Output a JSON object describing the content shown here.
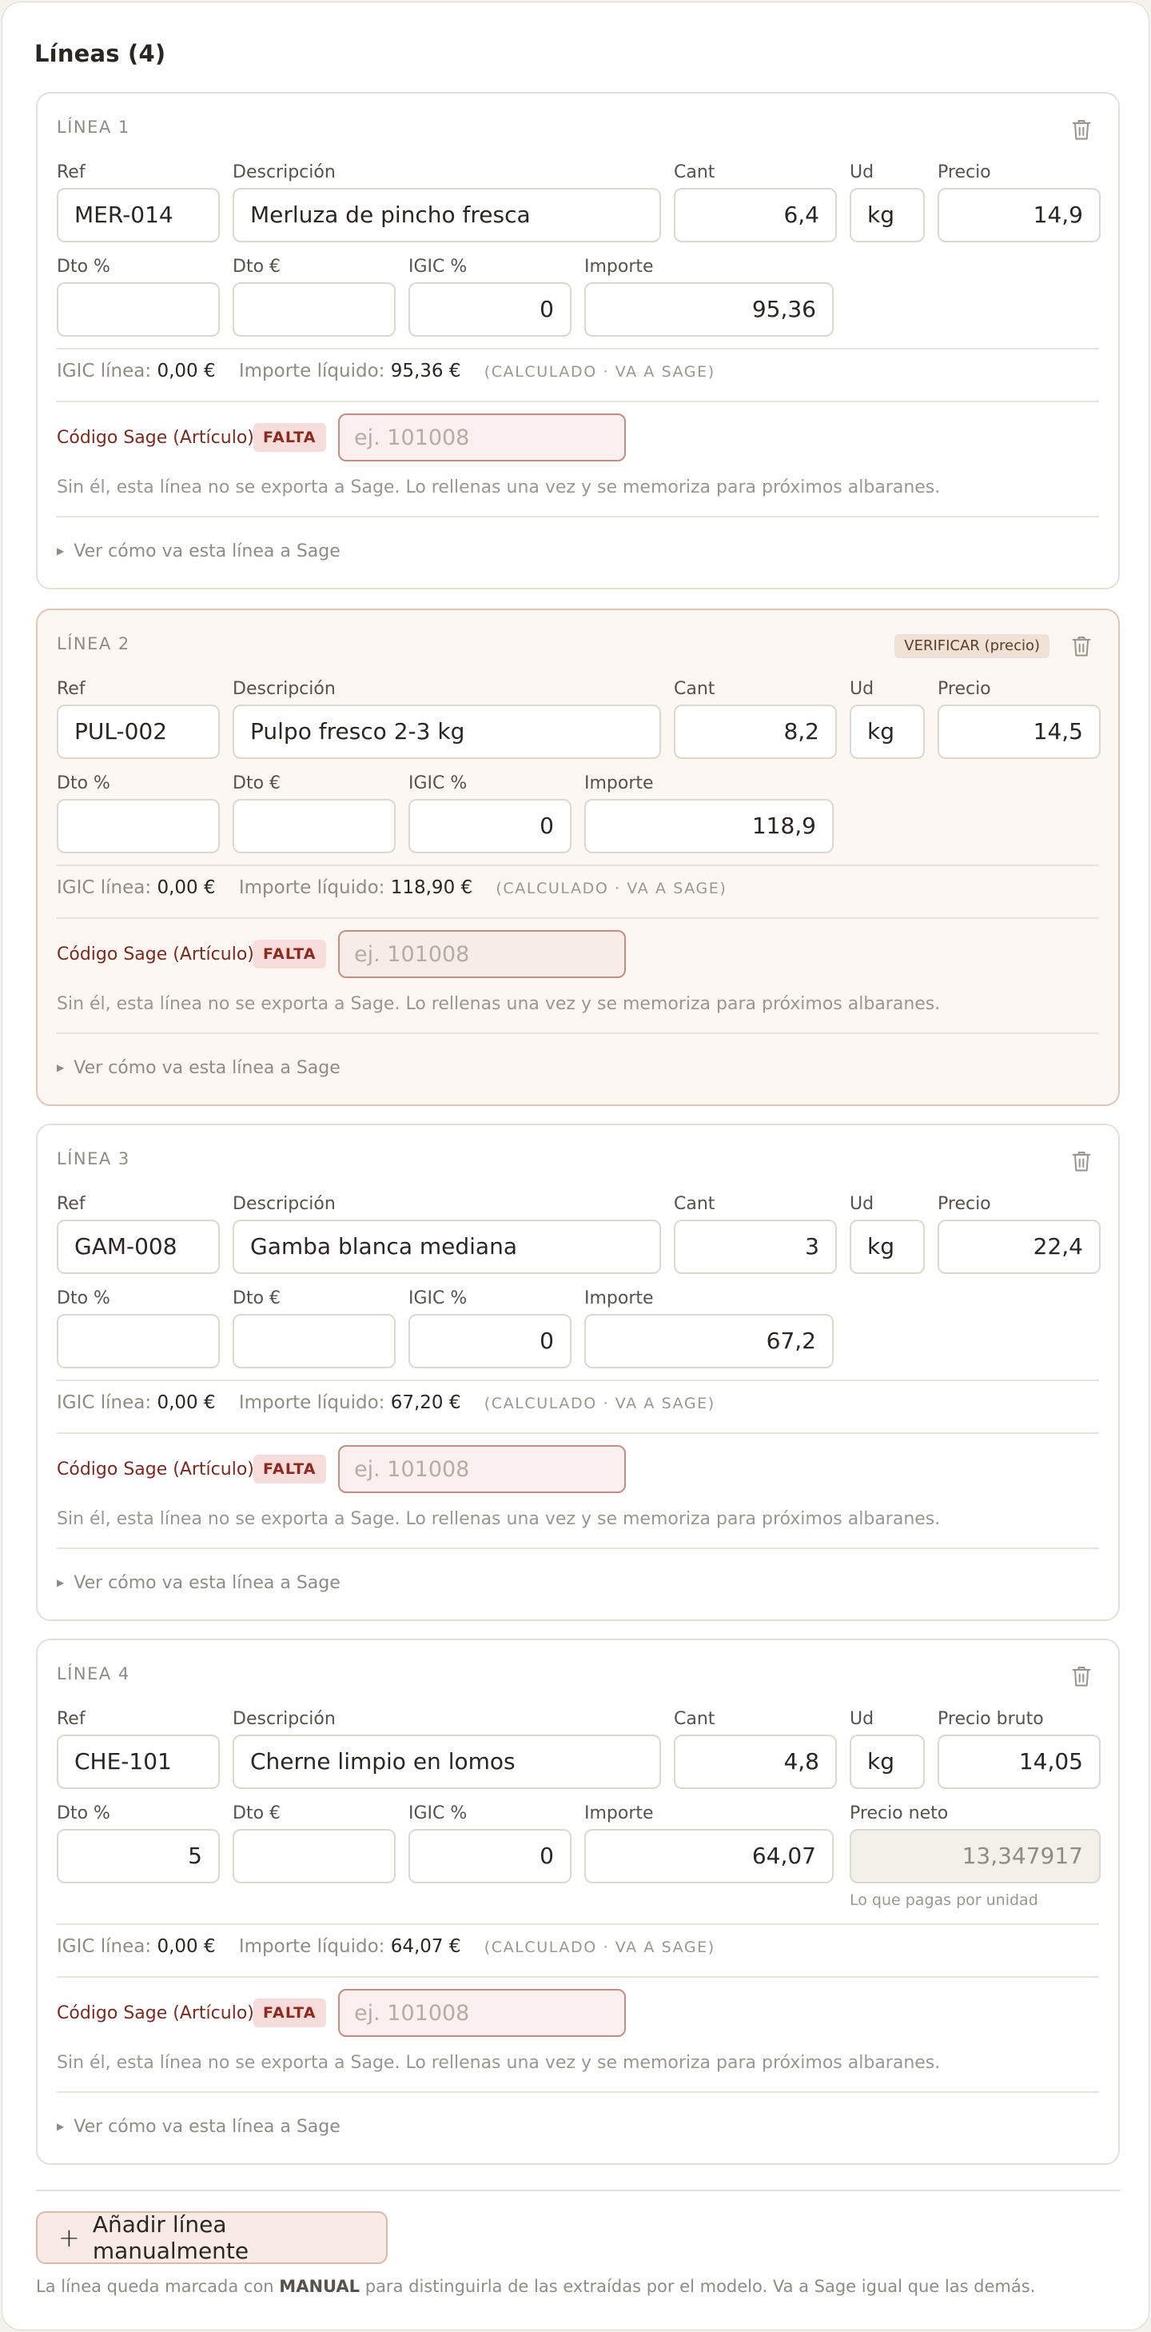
{
  "section": {
    "title": "Líneas (4)"
  },
  "labels": {
    "ref": "Ref",
    "descripcion": "Descripción",
    "cant": "Cant",
    "ud": "Ud",
    "precio": "Precio",
    "precio_bruto": "Precio bruto",
    "dto_pct": "Dto %",
    "dto_eur": "Dto €",
    "igic_pct": "IGIC %",
    "importe": "Importe",
    "precio_neto": "Precio neto",
    "precio_neto_hint": "Lo que pagas por unidad",
    "igic_linea": "IGIC línea:",
    "importe_liquido": "Importe líquido:",
    "calculado": "(CALCULADO · VA A SAGE)",
    "codigo_sage": "Código Sage (Artículo)",
    "falta": "FALTA",
    "sage_placeholder": "ej. 101008",
    "sage_note": "Sin él, esta línea no se exporta a Sage. Lo rellenas una vez y se memoriza para próximos albaranes.",
    "ver_como": "Ver cómo va esta línea a Sage"
  },
  "lines": [
    {
      "label": "LÍNEA 1",
      "verify": "",
      "ref": "MER-014",
      "desc": "Merluza de pincho fresca",
      "cant": "6,4",
      "ud": "kg",
      "precio": "14,9",
      "dto_pct": "",
      "dto_eur": "",
      "igic": "0",
      "importe": "95,36",
      "igic_linea": "0,00 €",
      "importe_liquido": "95,36 €"
    },
    {
      "label": "LÍNEA 2",
      "verify": "VERIFICAR (precio)",
      "ref": "PUL-002",
      "desc": "Pulpo fresco 2-3 kg",
      "cant": "8,2",
      "ud": "kg",
      "precio": "14,5",
      "dto_pct": "",
      "dto_eur": "",
      "igic": "0",
      "importe": "118,9",
      "igic_linea": "0,00 €",
      "importe_liquido": "118,90 €"
    },
    {
      "label": "LÍNEA 3",
      "verify": "",
      "ref": "GAM-008",
      "desc": "Gamba blanca mediana",
      "cant": "3",
      "ud": "kg",
      "precio": "22,4",
      "dto_pct": "",
      "dto_eur": "",
      "igic": "0",
      "importe": "67,2",
      "igic_linea": "0,00 €",
      "importe_liquido": "67,20 €"
    },
    {
      "label": "LÍNEA 4",
      "verify": "",
      "ref": "CHE-101",
      "desc": "Cherne limpio en lomos",
      "cant": "4,8",
      "ud": "kg",
      "precio": "14,05",
      "dto_pct": "5",
      "dto_eur": "",
      "igic": "0",
      "importe": "64,07",
      "precio_neto": "13,347917",
      "igic_linea": "0,00 €",
      "importe_liquido": "64,07 €"
    }
  ],
  "footer": {
    "add_button": "Añadir línea manualmente",
    "note_before": "La línea queda marcada con ",
    "note_bold": "MANUAL",
    "note_after": " para distinguirla de las extraídas por el modelo. Va a Sage igual que las demás."
  }
}
